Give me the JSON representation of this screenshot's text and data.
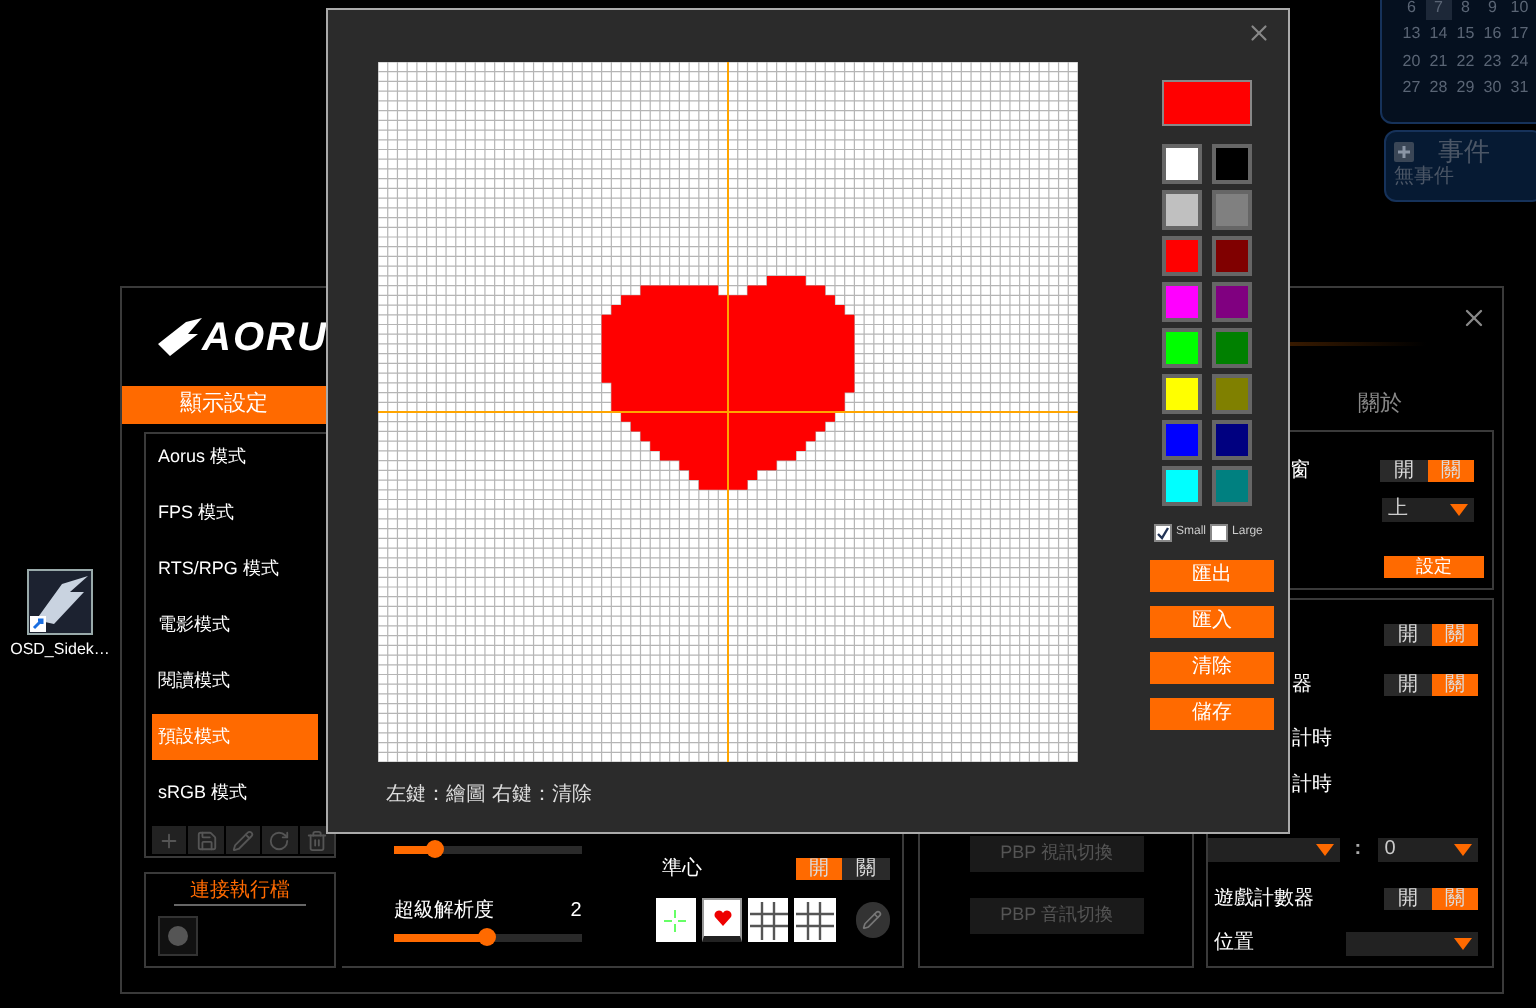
{
  "desktop": {
    "icon_label": "OSD_Sidek…"
  },
  "calendar": {
    "weeks": [
      [
        {
          "day": "6",
          "selected": false
        },
        {
          "day": "7",
          "selected": true
        },
        {
          "day": "8",
          "selected": false
        },
        {
          "day": "9",
          "selected": false
        },
        {
          "day": "10",
          "selected": false
        }
      ],
      [
        {
          "day": "13",
          "selected": false
        },
        {
          "day": "14",
          "selected": false
        },
        {
          "day": "15",
          "selected": false
        },
        {
          "day": "16",
          "selected": false
        },
        {
          "day": "17",
          "selected": false
        }
      ],
      [
        {
          "day": "20",
          "selected": false
        },
        {
          "day": "21",
          "selected": false
        },
        {
          "day": "22",
          "selected": false
        },
        {
          "day": "23",
          "selected": false
        },
        {
          "day": "24",
          "selected": false
        }
      ],
      [
        {
          "day": "27",
          "selected": false
        },
        {
          "day": "28",
          "selected": false
        },
        {
          "day": "29",
          "selected": false
        },
        {
          "day": "30",
          "selected": false
        },
        {
          "day": "31",
          "selected": false
        }
      ]
    ]
  },
  "events": {
    "title": "事件",
    "empty": "無事件"
  },
  "main_window": {
    "logo": "AORU",
    "tab": {
      "label": "顯示設定",
      "selected": true
    },
    "modes": [
      {
        "label": "Aorus 模式",
        "selected": false
      },
      {
        "label": "FPS 模式",
        "selected": false
      },
      {
        "label": "RTS/RPG 模式",
        "selected": false
      },
      {
        "label": "電影模式",
        "selected": false
      },
      {
        "label": "閱讀模式",
        "selected": false
      },
      {
        "label": "預設模式",
        "selected": true
      },
      {
        "label": "sRGB 模式",
        "selected": false
      }
    ],
    "link_section": {
      "title": "連接執行檔"
    },
    "sliders": [
      {
        "level": 0.22
      },
      {
        "label": "超級解析度",
        "value": "2",
        "level": 0.5
      }
    ],
    "crosshair": {
      "label": "準心",
      "toggle": {
        "options": [
          "開",
          "關"
        ],
        "on": true
      },
      "presets": [
        {
          "kind": "cross",
          "selected": false
        },
        {
          "kind": "heart",
          "selected": true
        },
        {
          "kind": "grid",
          "selected": false
        },
        {
          "kind": "grid",
          "selected": false
        }
      ]
    },
    "pbp_buttons": [
      "PBP 視訊切換",
      "PBP 音訊切換"
    ],
    "right_panel": {
      "title": "關於",
      "box1": {
        "label": "窗",
        "toggle": {
          "options": [
            "開",
            "關"
          ],
          "on": false
        },
        "dropdown": "上",
        "button": "設定"
      },
      "box2": {
        "rows": [
          {
            "toggle": {
              "options": [
                "開",
                "關"
              ],
              "on": false
            }
          },
          {
            "label": "器",
            "toggle": {
              "options": [
                "開",
                "關"
              ],
              "on": false
            }
          },
          {
            "label": "計時"
          },
          {
            "label": "計時"
          }
        ],
        "time_separator": ":",
        "minutes": "0",
        "counter": {
          "label": "遊戲計數器",
          "toggle": {
            "options": [
              "開",
              "關"
            ],
            "on": false
          }
        },
        "position": {
          "label": "位置"
        }
      }
    }
  },
  "dialog": {
    "current_swatch": {
      "color": "#ff0000"
    },
    "palette": [
      {
        "color": "#ffffff"
      },
      {
        "color": "#000000"
      },
      {
        "color": "#c0c0c0"
      },
      {
        "color": "#808080"
      },
      {
        "color": "#ff0000"
      },
      {
        "color": "#800000"
      },
      {
        "color": "#ff00ff"
      },
      {
        "color": "#800080"
      },
      {
        "color": "#00ff00"
      },
      {
        "color": "#008000"
      },
      {
        "color": "#ffff00"
      },
      {
        "color": "#808000"
      },
      {
        "color": "#0000ff"
      },
      {
        "color": "#000080"
      },
      {
        "color": "#00ffff"
      },
      {
        "color": "#008080"
      }
    ],
    "sizes": [
      {
        "label": "Small",
        "checked": true
      },
      {
        "label": "Large",
        "checked": false
      }
    ],
    "buttons": [
      "匯出",
      "匯入",
      "清除",
      "儲存"
    ],
    "hint": "左鍵：繪圖 右鍵：清除"
  }
}
